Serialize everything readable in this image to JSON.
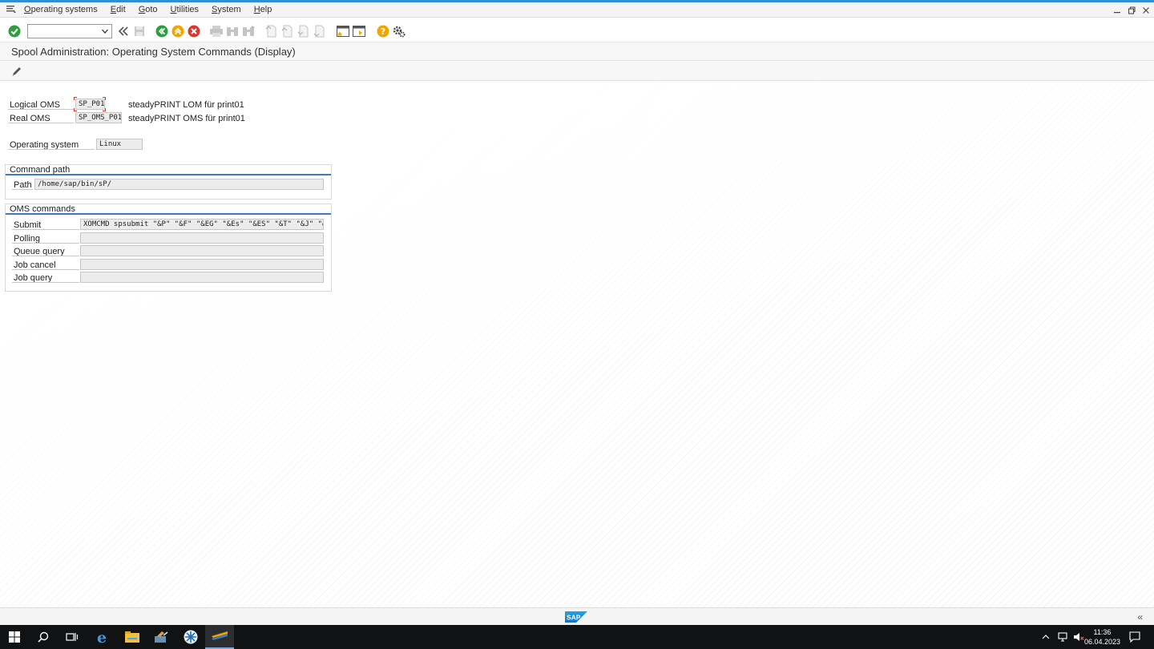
{
  "menu": {
    "items": [
      "Operating systems",
      "Edit",
      "Goto",
      "Utilities",
      "System",
      "Help"
    ]
  },
  "toolbar": {
    "command_field_value": "",
    "icons": [
      "enter-icon",
      "command-dropdown",
      "collapse-icon",
      "save-icon",
      "back-icon",
      "exit-icon",
      "cancel-icon",
      "print-icon",
      "find-icon",
      "find-next-icon",
      "first-page-icon",
      "previous-page-icon",
      "next-page-icon",
      "last-page-icon",
      "new-session-icon",
      "shortcut-icon",
      "help-icon",
      "settings-icon"
    ]
  },
  "page": {
    "title": "Spool Administration: Operating System Commands (Display)"
  },
  "form": {
    "logical_oms": {
      "label": "Logical OMS",
      "value": "SP_P01",
      "description": "steadyPRINT LOM für print01"
    },
    "real_oms": {
      "label": "Real OMS",
      "value": "SP_OMS_P01",
      "description": "steadyPRINT OMS für print01"
    },
    "operating_system": {
      "label": "Operating system",
      "value": "Linux"
    }
  },
  "command_path": {
    "title": "Command path",
    "path_label": "Path",
    "path_value": "/home/sap/bin/sP/"
  },
  "oms_commands": {
    "title": "OMS commands",
    "rows": [
      {
        "label": "Submit",
        "value": "XOMCMD spsubmit \"&P\" \"&F\" \"&EG\" \"&Es\" \"&ES\" \"&T\" \"&J\" \"&…"
      },
      {
        "label": "Polling",
        "value": ""
      },
      {
        "label": "Queue query",
        "value": ""
      },
      {
        "label": "Job cancel",
        "value": ""
      },
      {
        "label": "Job query",
        "value": ""
      }
    ]
  },
  "footer": {
    "logo": "SAP",
    "collapse": "«"
  },
  "taskbar": {
    "time": "11:36",
    "date": "06.04.2023"
  },
  "colors": {
    "accent": "#3a7cc1",
    "topline": "#2d8fd5",
    "enter_green": "#2f9e41",
    "cancel_red": "#d63a2c",
    "back_orange": "#f0a500"
  }
}
